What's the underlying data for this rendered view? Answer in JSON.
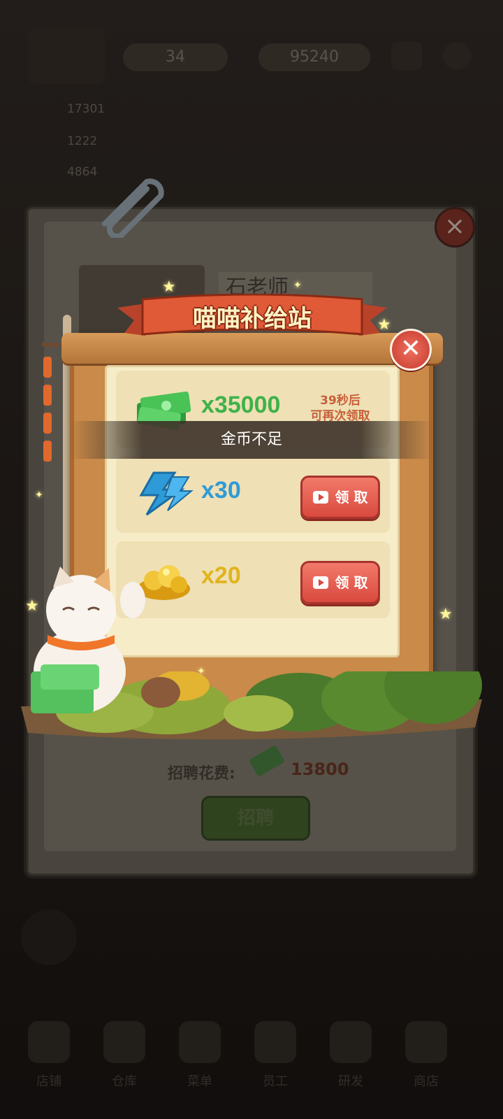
{
  "background_game": {
    "resource_gems": "34",
    "resource_cash": "95240",
    "stats": [
      {
        "value": "17301"
      },
      {
        "value": "1222"
      },
      {
        "value": "4864"
      }
    ],
    "nav": [
      "店铺",
      "仓库",
      "菜单",
      "员工",
      "研发",
      "商店"
    ]
  },
  "recruit_panel": {
    "name": "石老师",
    "cost_label": "招聘花费:",
    "cost_value": "13800",
    "recruit_button": "招聘"
  },
  "supply_station": {
    "title": "喵喵补给站",
    "rewards": [
      {
        "icon": "cash-stack-icon",
        "quantity": "x35000",
        "cooldown_line1": "39秒后",
        "cooldown_line2": "可再次领取",
        "color": "#3fb24a"
      },
      {
        "icon": "lightning-icon",
        "quantity": "x30",
        "claim_label": "领 取",
        "color": "#2e9bd8"
      },
      {
        "icon": "gold-nuggets-icon",
        "quantity": "x20",
        "claim_label": "领 取",
        "color": "#e0b41c"
      }
    ]
  },
  "toast": {
    "message": "金币不足"
  },
  "colors": {
    "claim_button": "#d9493e",
    "frame_wood": "#c98a4a",
    "panel_bg": "#f7ecc8"
  }
}
